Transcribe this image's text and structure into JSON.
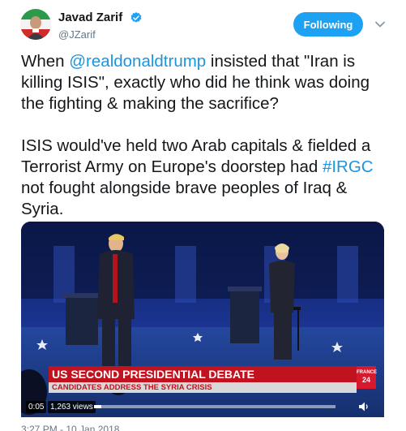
{
  "author": {
    "display_name": "Javad Zarif",
    "handle": "@JZarif",
    "verified": true
  },
  "follow_button": {
    "label": "Following"
  },
  "tweet": {
    "p1": {
      "before": "When ",
      "mention": "@realdonaldtrump",
      "after": " insisted that \"Iran is killing ISIS\", exactly who did he think was doing the fighting & making the sacrifice?"
    },
    "p2": {
      "before": "ISIS would've held two Arab capitals & fielded a Terrorist Army on Europe's doorstep had ",
      "hashtag": "#IRGC",
      "after": " not fought alongside brave peoples of Iraq & Syria."
    }
  },
  "video": {
    "headline": "US SECOND PRESIDENTIAL DEBATE",
    "subheadline": "CANDIDATES ADDRESS THE SYRIA CRISIS",
    "brand_top": "FRANCE",
    "brand_num": "24",
    "elapsed": "0:05",
    "views": "1,263 views",
    "progress_fraction": 0.03
  },
  "colors": {
    "accent": "#1da1f2",
    "link": "#1b95e0",
    "banner_red": "#c1121f"
  },
  "icons": {
    "verified": "verified-badge-icon",
    "caret": "chevron-down-icon",
    "volume": "speaker-icon"
  },
  "footer": {
    "text": "3:27 PM - 10 Jan 2018"
  }
}
